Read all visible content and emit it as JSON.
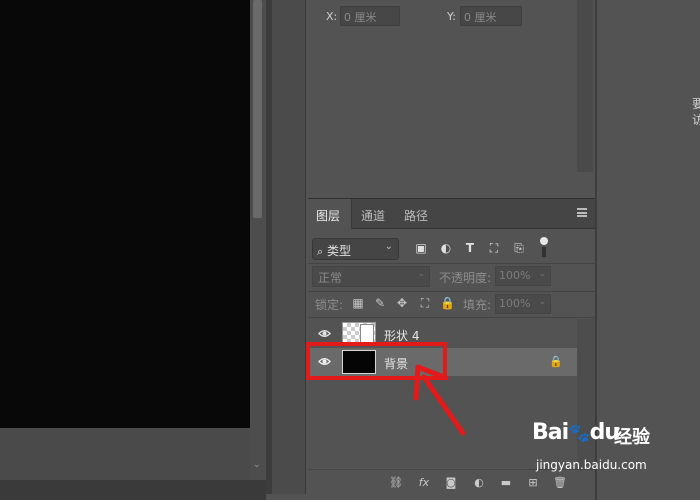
{
  "properties": {
    "x_label": "X:",
    "x_value": "0 厘米",
    "y_label": "Y:",
    "y_value": "0 厘米"
  },
  "layers_panel": {
    "tabs": [
      {
        "label": "图层",
        "active": true
      },
      {
        "label": "通道",
        "active": false
      },
      {
        "label": "路径",
        "active": false
      }
    ],
    "filter": {
      "label": "类型",
      "icons": [
        "image-filter-icon",
        "adjustment-filter-icon",
        "type-filter-icon",
        "shape-filter-icon",
        "smart-object-filter-icon"
      ]
    },
    "blend_mode": "正常",
    "opacity_label": "不透明度:",
    "opacity_value": "100%",
    "lock_label": "锁定:",
    "lock_icons": [
      "lock-transparent-icon",
      "lock-image-icon",
      "lock-position-icon",
      "lock-artboard-icon",
      "lock-all-icon"
    ],
    "fill_label": "填充:",
    "fill_value": "100%",
    "layers": [
      {
        "name": "形状 4",
        "visible": true,
        "selected": false,
        "locked": false,
        "type": "shape"
      },
      {
        "name": "背景",
        "visible": true,
        "selected": true,
        "locked": true,
        "type": "background"
      }
    ],
    "footer_tools": [
      {
        "name": "link-layers-icon",
        "glyph": "⛓"
      },
      {
        "name": "layer-style-icon",
        "glyph": "fx"
      },
      {
        "name": "layer-mask-icon",
        "glyph": "◙"
      },
      {
        "name": "adjustment-layer-icon",
        "glyph": "◐"
      },
      {
        "name": "new-group-icon",
        "glyph": "▬"
      },
      {
        "name": "new-layer-icon",
        "glyph": "⊞"
      },
      {
        "name": "delete-layer-icon",
        "glyph": "🗑"
      }
    ]
  },
  "right_panel": {
    "text_line1": "要",
    "text_line2": "访"
  },
  "watermark": {
    "logo": "Bai",
    "logo_tail": "du",
    "cn": "经验",
    "url": "jingyan.baidu.com"
  },
  "colors": {
    "annotation": "#e21a1a",
    "panel_bg": "#535353",
    "canvas": "#080808"
  }
}
